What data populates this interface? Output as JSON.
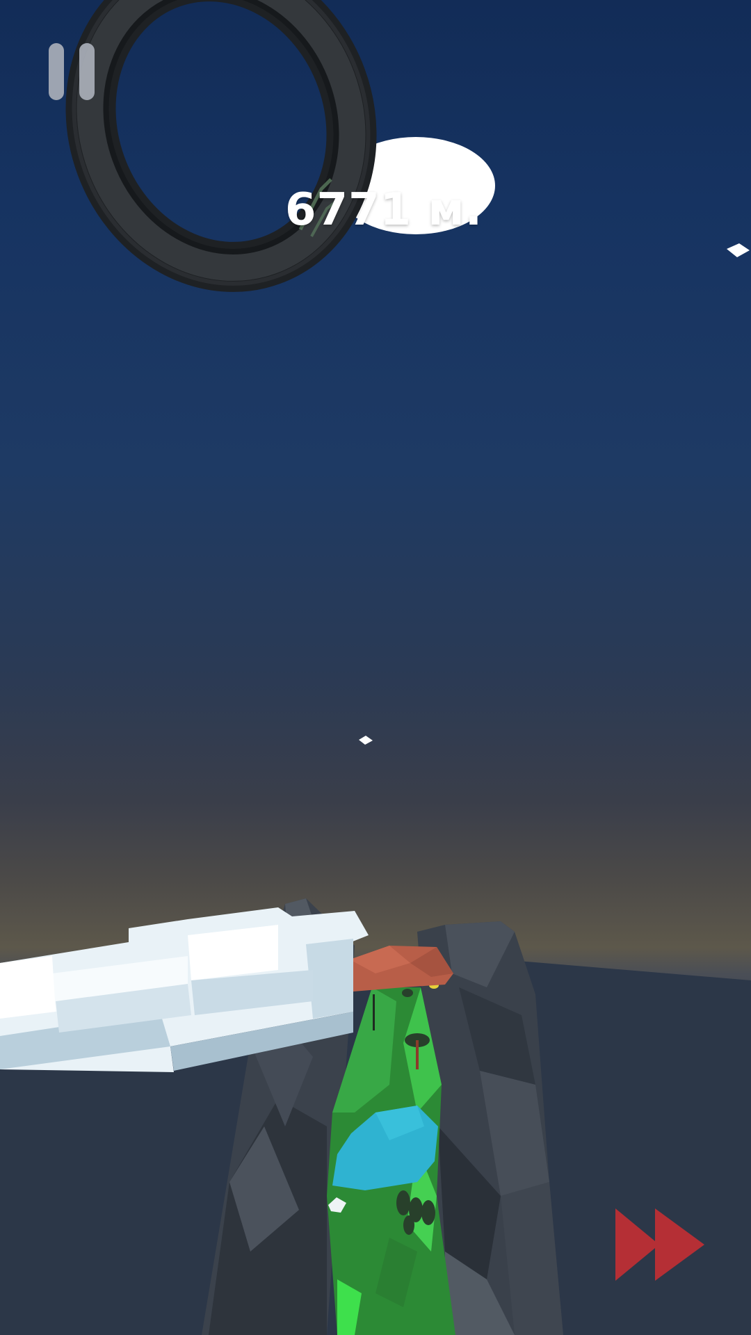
{
  "hud": {
    "distance_label": "6771 м.",
    "pause_icon": "pause-icon",
    "fast_forward_icon": "fast-forward-icon"
  },
  "colors": {
    "sky_top": "#122c57",
    "horizon_glow": "#5d584b",
    "sea": "#2b3647",
    "rock": "#3c434d",
    "grass": "#2f9a3a",
    "water": "#2fb3d1",
    "roof": "#b85e48",
    "cloud": "#eef6fb",
    "fast_forward": "#b52f35",
    "pause": "#a9afb8"
  }
}
